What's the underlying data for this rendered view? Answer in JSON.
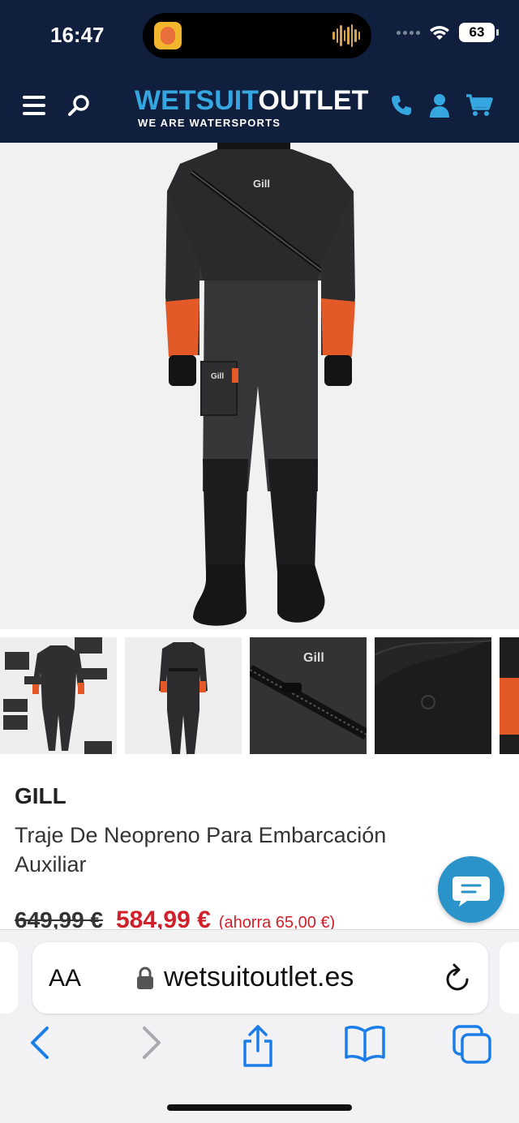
{
  "status_bar": {
    "time": "16:47",
    "battery": "63"
  },
  "header": {
    "logo_part1": "WETSUIT",
    "logo_part2": "OUTLET",
    "tagline": "WE ARE WATERSPORTS",
    "icons": [
      "menu-icon",
      "search-icon",
      "phone-icon",
      "user-icon",
      "cart-icon"
    ],
    "background": "#0f1f3d",
    "accent": "#35a6e0"
  },
  "product": {
    "brand": "GILL",
    "title": "Traje De Neopreno Para Embarcación Auxiliar",
    "old_price": "649,99 €",
    "price": "584,99 €",
    "savings": "(ahorra 65,00 €)",
    "thumbnails": [
      "front-diagram",
      "back-view",
      "zipper-detail",
      "shoulder-detail",
      "sleeve-detail"
    ],
    "price_color": "#d2202a"
  },
  "browser": {
    "text_size_label": "AA",
    "url": "wetsuitoutlet.es",
    "nav": [
      "back-icon",
      "forward-icon",
      "share-icon",
      "bookmarks-icon",
      "tabs-icon"
    ]
  }
}
